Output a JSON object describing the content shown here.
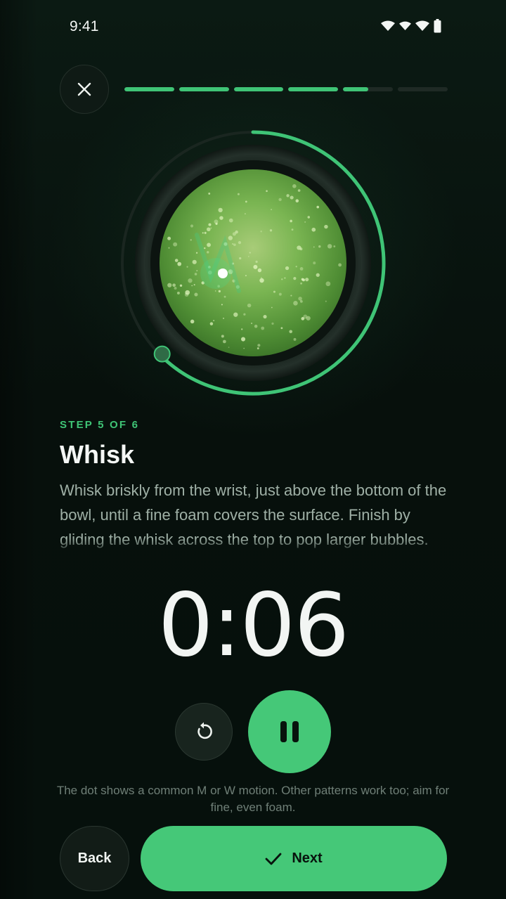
{
  "status_bar": {
    "time": "9:41",
    "icons": [
      "wifi-icon",
      "wifi-icon",
      "wifi-icon",
      "battery-icon"
    ]
  },
  "header": {
    "close_icon": "close-icon",
    "progress_segments": [
      1,
      1,
      1,
      1,
      0.5,
      0
    ]
  },
  "visual": {
    "ring_progress": 0.62,
    "accent_color": "#3fc476"
  },
  "step": {
    "label": "STEP 5 OF 6",
    "title": "Whisk",
    "description": "Whisk briskly from the wrist, just above the bottom of the bowl, until a fine foam covers the surface. Finish by gliding the whisk across the top to pop larger bubbles."
  },
  "timer": {
    "value": "0:06"
  },
  "controls": {
    "restart_icon": "restart-icon",
    "pause_icon": "pause-icon"
  },
  "hint": "The dot shows a common M or W motion. Other patterns work too; aim for fine, even foam.",
  "footer": {
    "back_label": "Back",
    "next_label": "Next",
    "next_icon": "check-icon"
  },
  "colors": {
    "accent": "#45c878",
    "background": "#08110d"
  }
}
